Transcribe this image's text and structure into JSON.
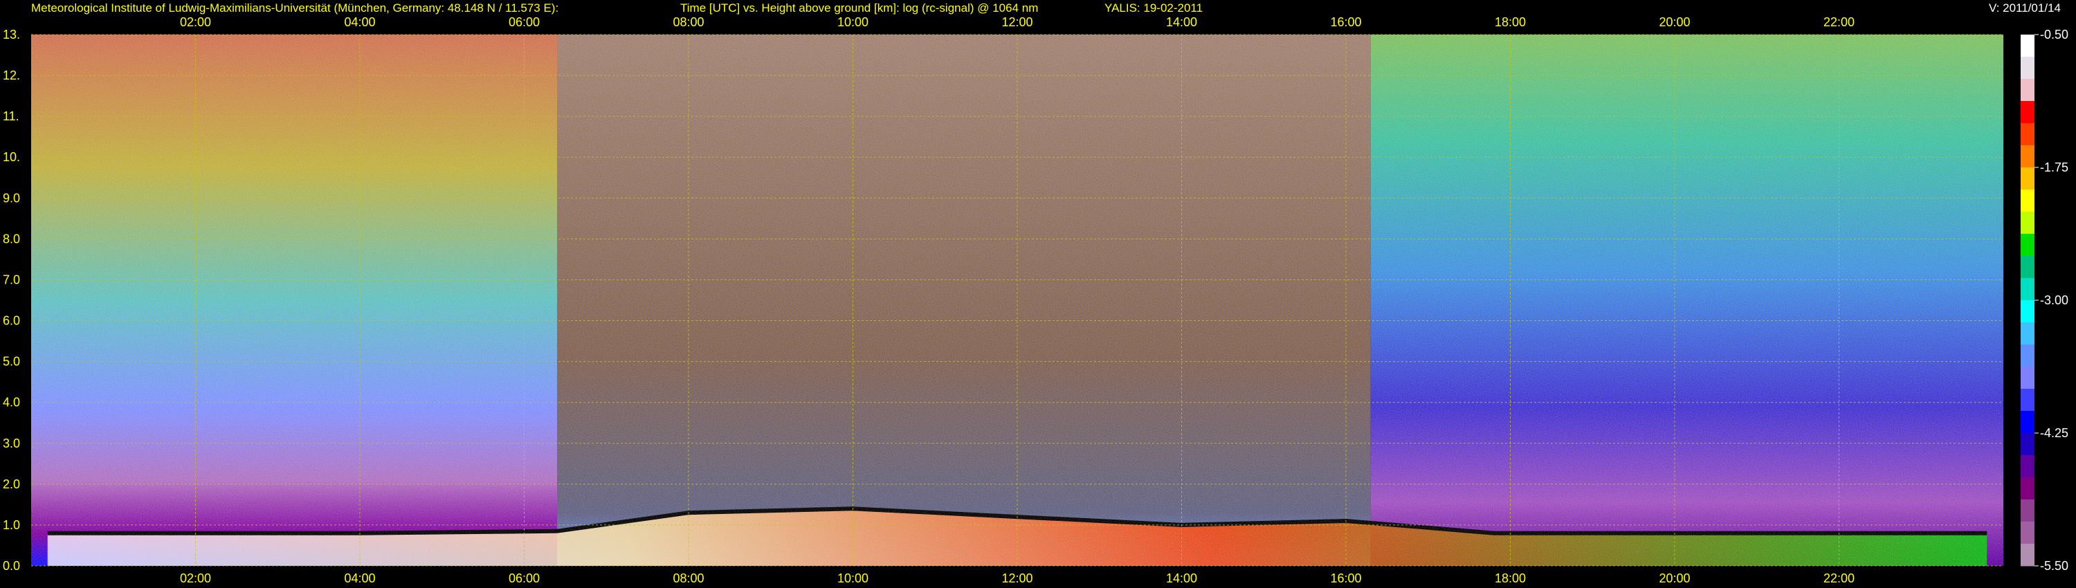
{
  "header": {
    "institute": "Meteorological Institute of Ludwig-Maximilians-Universität (München, Germany: 48.148 N / 11.573 E):",
    "plot_desc": "Time [UTC] vs. Height above ground [km]: log (rc-signal) @ 1064 nm",
    "instrument_date": "YALIS: 19-02-2011",
    "version": "V: 2011/01/14"
  },
  "colors": {
    "text": "#ffff00",
    "version_text": "#ffffff",
    "grid": "#c8c800",
    "background": "#000000"
  },
  "chart_data": {
    "type": "heatmap",
    "title": "",
    "xlabel": "Time [UTC]",
    "ylabel": "Height above ground [km]",
    "xlim": [
      0,
      24
    ],
    "ylim": [
      0,
      13
    ],
    "x_ticks": [
      "02:00",
      "04:00",
      "06:00",
      "08:00",
      "10:00",
      "12:00",
      "14:00",
      "16:00",
      "18:00",
      "20:00",
      "22:00"
    ],
    "x_tick_hours": [
      2,
      4,
      6,
      8,
      10,
      12,
      14,
      16,
      18,
      20,
      22
    ],
    "y_ticks": [
      "0.0",
      "1.0",
      "2.0",
      "3.0",
      "4.0",
      "5.0",
      "6.0",
      "7.0",
      "8.0",
      "9.0",
      "10.",
      "11.",
      "12.",
      "13."
    ],
    "y_tick_values": [
      0,
      1,
      2,
      3,
      4,
      5,
      6,
      7,
      8,
      9,
      10,
      11,
      12,
      13
    ],
    "grid": true,
    "colorbar": {
      "range": [
        -5.5,
        -0.5
      ],
      "ticks": [
        "-0.50",
        "-1.75",
        "-3.00",
        "-4.25",
        "-5.50"
      ],
      "tick_values": [
        -0.5,
        -1.75,
        -3.0,
        -4.25,
        -5.5
      ],
      "colors": [
        "#ffffff",
        "#e8e0e8",
        "#f0c0c8",
        "#ff0000",
        "#ff4000",
        "#ff8000",
        "#ffc000",
        "#ffff00",
        "#c0ff00",
        "#00e000",
        "#00c080",
        "#00e0c0",
        "#00ffff",
        "#40c0ff",
        "#6090ff",
        "#8080ff",
        "#4040ff",
        "#0000ff",
        "#2000c0",
        "#6000a0",
        "#800080",
        "#904090",
        "#a060a0",
        "#b090b0"
      ]
    },
    "boundary_layer_top_km": [
      {
        "hour": 0.2,
        "height": 0.8
      },
      {
        "hour": 2,
        "height": 0.8
      },
      {
        "hour": 4,
        "height": 0.8
      },
      {
        "hour": 6.4,
        "height": 0.85
      },
      {
        "hour": 8,
        "height": 1.3
      },
      {
        "hour": 10,
        "height": 1.4
      },
      {
        "hour": 12,
        "height": 1.2
      },
      {
        "hour": 14,
        "height": 1.0
      },
      {
        "hour": 16,
        "height": 1.1
      },
      {
        "hour": 17.8,
        "height": 0.8
      },
      {
        "hour": 20,
        "height": 0.8
      },
      {
        "hour": 23.8,
        "height": 0.8
      }
    ]
  }
}
